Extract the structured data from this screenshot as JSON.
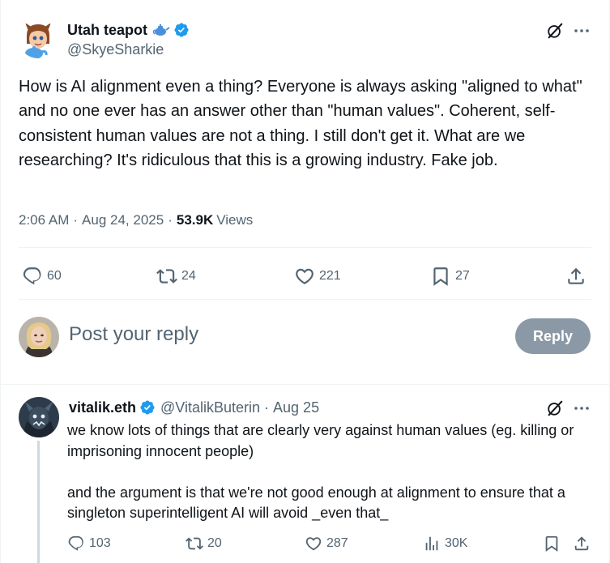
{
  "main_tweet": {
    "display_name": "Utah teapot",
    "handle": "@SkyeSharkie",
    "text": "How is AI alignment even a thing? Everyone is always asking \"aligned to what\" and no one ever has an answer other than \"human values\". Coherent, self-consistent human values are not a thing. I still don't get it. What are we researching? It's ridiculous that this is a growing industry. Fake job.",
    "time": "2:06 AM",
    "date": "Aug 24, 2025",
    "views_count": "53.9K",
    "views_label": "Views",
    "replies": "60",
    "reposts": "24",
    "likes": "221",
    "bookmarks": "27"
  },
  "composer": {
    "placeholder": "Post your reply",
    "button_label": "Reply"
  },
  "reply_tweet": {
    "display_name": "vitalik.eth",
    "handle": "@VitalikButerin",
    "date": "Aug 25",
    "text_line1": "we know lots of things that are clearly very against human values (eg. killing or imprisoning innocent people)",
    "text_line2": "and the argument is that we're not good enough at alignment to ensure that a singleton superintelligent AI will avoid _even that_",
    "replies": "103",
    "reposts": "20",
    "likes": "287",
    "views": "30K"
  },
  "separator": "·",
  "colors": {
    "text": "#0f1419",
    "secondary": "#536471",
    "verified": "#1d9bf0",
    "reply_button": "#8b98a5"
  },
  "icons": [
    "teapot-icon",
    "verified-icon",
    "grok-icon",
    "more-icon",
    "reply-icon",
    "repost-icon",
    "like-icon",
    "bookmark-icon",
    "share-icon",
    "views-icon"
  ]
}
